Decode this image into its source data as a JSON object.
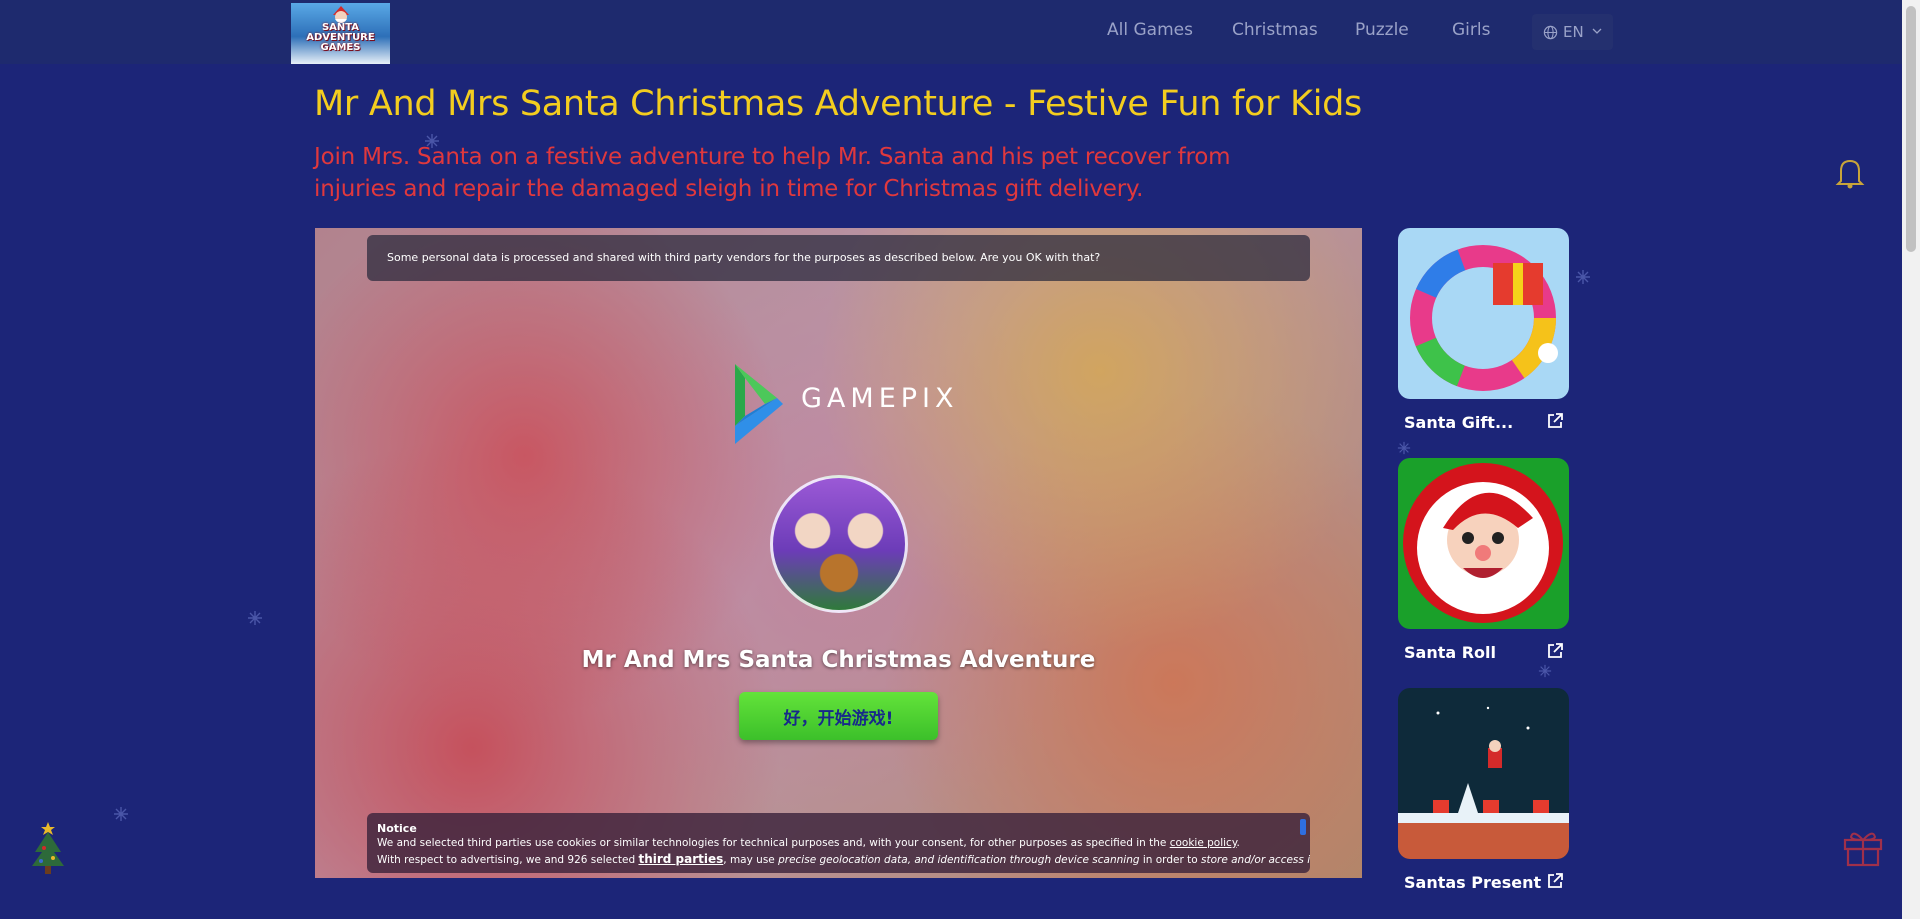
{
  "header": {
    "logo_text_line1": "SANTA",
    "logo_text_line2": "ADVENTURE",
    "logo_text_line3": "GAMES",
    "nav": [
      "All Games",
      "Christmas",
      "Puzzle",
      "Girls"
    ],
    "language": "EN"
  },
  "page": {
    "title": "Mr And Mrs Santa Christmas Adventure - Festive Fun for Kids",
    "description": "Join Mrs. Santa on a festive adventure to help Mr. Santa and his pet recover from injuries and repair the damaged sleigh in time for Christmas gift delivery."
  },
  "game": {
    "consent_prompt": "Some personal data is processed and shared with third party vendors for the purposes as described below. Are you OK with that?",
    "publisher": "GAMEPIX",
    "name": "Mr And Mrs Santa Christmas Adventure",
    "play_button": "好，开始游戏!",
    "notice_title": "Notice",
    "notice_line1_a": "We and selected third parties use cookies or similar technologies for technical purposes and, with your consent, for other purposes as specified in the ",
    "notice_line1_link": "cookie policy",
    "notice_line1_b": ".",
    "notice_line2_a": "With respect to advertising, we and 926 selected ",
    "notice_line2_link": "third parties",
    "notice_line2_b": ", may use ",
    "notice_line2_c": "precise geolocation data, and identification through device scanning",
    "notice_line2_d": " in order to ",
    "notice_line2_e": "store and/or access information"
  },
  "related_games": [
    {
      "name": "Santa Gift..."
    },
    {
      "name": "Santa Roll"
    },
    {
      "name": "Santas Present"
    }
  ],
  "colors": {
    "background": "#1c2578",
    "header": "#1e2a6e",
    "title": "#f3cd1f",
    "description": "#e0383d",
    "play_button": "#4ed132"
  }
}
